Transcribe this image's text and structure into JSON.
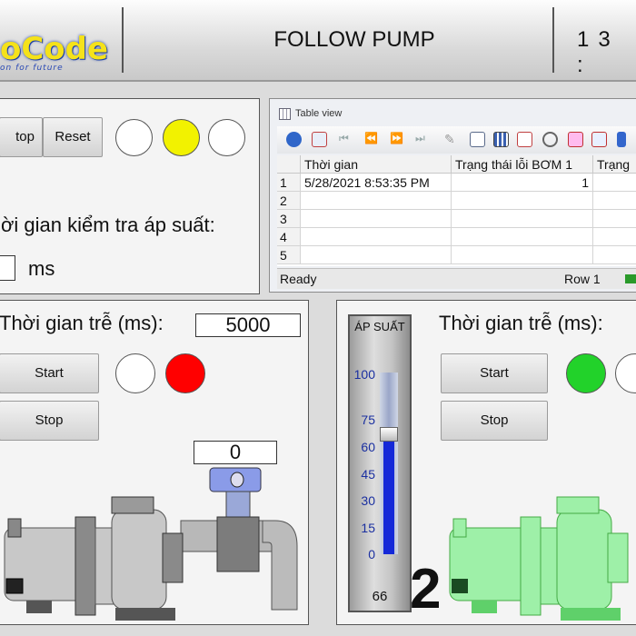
{
  "header": {
    "logo_text": "oCode",
    "logo_tagline": "on for future",
    "title": "FOLLOW PUMP",
    "clock": "13 :"
  },
  "control_panel": {
    "stop_label": "top",
    "reset_label": "Reset",
    "lamps": [
      {
        "state": "off",
        "color": "#ffffff"
      },
      {
        "state": "on",
        "color": "#f2f200"
      },
      {
        "state": "off",
        "color": "#ffffff"
      }
    ],
    "check_label": "ời gian kiểm tra áp suất:",
    "check_value": "",
    "check_unit": "ms"
  },
  "table_view": {
    "title": "Table view",
    "columns": [
      "Thời gian",
      "Trạng thái lỗi BƠM 1",
      "Trạng"
    ],
    "rows": [
      {
        "n": "1",
        "time": "5/28/2021 8:53:35 PM",
        "err1": "1",
        "err2": ""
      },
      {
        "n": "2",
        "time": "",
        "err1": "",
        "err2": ""
      },
      {
        "n": "3",
        "time": "",
        "err1": "",
        "err2": ""
      },
      {
        "n": "4",
        "time": "",
        "err1": "",
        "err2": ""
      },
      {
        "n": "5",
        "time": "",
        "err1": "",
        "err2": ""
      }
    ],
    "status_text": "Ready",
    "row_indicator": "Row 1"
  },
  "pump1": {
    "delay_label": "Thời gian trễ (ms):",
    "delay_value": "5000",
    "start_label": "Start",
    "stop_label": "Stop",
    "lamps": [
      {
        "state": "off",
        "color": "#ffffff"
      },
      {
        "state": "on",
        "color": "#ff0000"
      }
    ],
    "sensor_value": "0",
    "body_color": "#c8c8c8"
  },
  "pressure_gauge": {
    "title": "ÁP SUẤT",
    "ticks": [
      "100",
      "75",
      "60",
      "45",
      "30",
      "15",
      "0"
    ],
    "value": "66",
    "max": 100,
    "fill_color": "#1428d8"
  },
  "pump2": {
    "number": "2",
    "delay_label": "Thời gian trễ (ms):",
    "start_label": "Start",
    "stop_label": "Stop",
    "lamps": [
      {
        "state": "on",
        "color": "#22d22a"
      },
      {
        "state": "off",
        "color": "#ffffff"
      }
    ],
    "body_color": "#9ef0a8"
  }
}
